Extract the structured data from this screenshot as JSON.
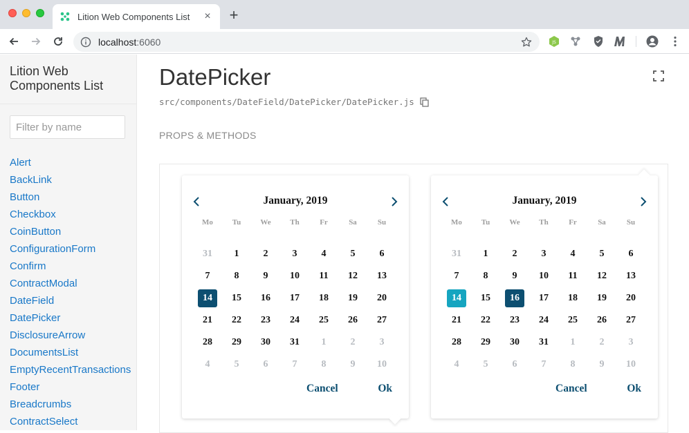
{
  "browser": {
    "tab_title": "Lition Web Components List",
    "tab_close": "×",
    "new_tab": "+",
    "url_host": "localhost",
    "url_port": ":6060"
  },
  "sidebar": {
    "title": "Lition Web Components List",
    "filter_placeholder": "Filter by name",
    "items": [
      "Alert",
      "BackLink",
      "Button",
      "Checkbox",
      "CoinButton",
      "ConfigurationForm",
      "Confirm",
      "ContractModal",
      "DateField",
      "DatePicker",
      "DisclosureArrow",
      "DocumentsList",
      "EmptyRecentTransactions",
      "Footer",
      "Breadcrumbs",
      "ContractSelect"
    ]
  },
  "main": {
    "title": "DatePicker",
    "path": "src/components/DateField/DatePicker/DatePicker.js",
    "props_label": "PROPS & METHODS"
  },
  "datepickers": [
    {
      "month": "January, 2019",
      "dows": [
        "Mo",
        "Tu",
        "We",
        "Th",
        "Fr",
        "Sa",
        "Su"
      ],
      "days": [
        {
          "d": "31",
          "out": true
        },
        {
          "d": "1"
        },
        {
          "d": "2"
        },
        {
          "d": "3"
        },
        {
          "d": "4"
        },
        {
          "d": "5"
        },
        {
          "d": "6"
        },
        {
          "d": "7"
        },
        {
          "d": "8"
        },
        {
          "d": "9"
        },
        {
          "d": "10"
        },
        {
          "d": "11"
        },
        {
          "d": "12"
        },
        {
          "d": "13"
        },
        {
          "d": "14",
          "state": "sel"
        },
        {
          "d": "15"
        },
        {
          "d": "16"
        },
        {
          "d": "17"
        },
        {
          "d": "18"
        },
        {
          "d": "19"
        },
        {
          "d": "20"
        },
        {
          "d": "21"
        },
        {
          "d": "22"
        },
        {
          "d": "23"
        },
        {
          "d": "24"
        },
        {
          "d": "25"
        },
        {
          "d": "26"
        },
        {
          "d": "27"
        },
        {
          "d": "28"
        },
        {
          "d": "29"
        },
        {
          "d": "30"
        },
        {
          "d": "31"
        },
        {
          "d": "1",
          "out": true
        },
        {
          "d": "2",
          "out": true
        },
        {
          "d": "3",
          "out": true
        },
        {
          "d": "4",
          "out": true
        },
        {
          "d": "5",
          "out": true
        },
        {
          "d": "6",
          "out": true
        },
        {
          "d": "7",
          "out": true
        },
        {
          "d": "8",
          "out": true
        },
        {
          "d": "9",
          "out": true
        },
        {
          "d": "10",
          "out": true
        }
      ],
      "cancel": "Cancel",
      "ok": "Ok"
    },
    {
      "month": "January, 2019",
      "dows": [
        "Mo",
        "Tu",
        "We",
        "Th",
        "Fr",
        "Sa",
        "Su"
      ],
      "days": [
        {
          "d": "31",
          "out": true
        },
        {
          "d": "1"
        },
        {
          "d": "2"
        },
        {
          "d": "3"
        },
        {
          "d": "4"
        },
        {
          "d": "5"
        },
        {
          "d": "6"
        },
        {
          "d": "7"
        },
        {
          "d": "8"
        },
        {
          "d": "9"
        },
        {
          "d": "10"
        },
        {
          "d": "11"
        },
        {
          "d": "12"
        },
        {
          "d": "13"
        },
        {
          "d": "14",
          "state": "today"
        },
        {
          "d": "15"
        },
        {
          "d": "16",
          "state": "sel"
        },
        {
          "d": "17"
        },
        {
          "d": "18"
        },
        {
          "d": "19"
        },
        {
          "d": "20"
        },
        {
          "d": "21"
        },
        {
          "d": "22"
        },
        {
          "d": "23"
        },
        {
          "d": "24"
        },
        {
          "d": "25"
        },
        {
          "d": "26"
        },
        {
          "d": "27"
        },
        {
          "d": "28"
        },
        {
          "d": "29"
        },
        {
          "d": "30"
        },
        {
          "d": "31"
        },
        {
          "d": "1",
          "out": true
        },
        {
          "d": "2",
          "out": true
        },
        {
          "d": "3",
          "out": true
        },
        {
          "d": "4",
          "out": true
        },
        {
          "d": "5",
          "out": true
        },
        {
          "d": "6",
          "out": true
        },
        {
          "d": "7",
          "out": true
        },
        {
          "d": "8",
          "out": true
        },
        {
          "d": "9",
          "out": true
        },
        {
          "d": "10",
          "out": true
        }
      ],
      "cancel": "Cancel",
      "ok": "Ok"
    }
  ],
  "colors": {
    "accent": "#0d4f71",
    "today": "#16a5c0",
    "link": "#1978c8"
  }
}
